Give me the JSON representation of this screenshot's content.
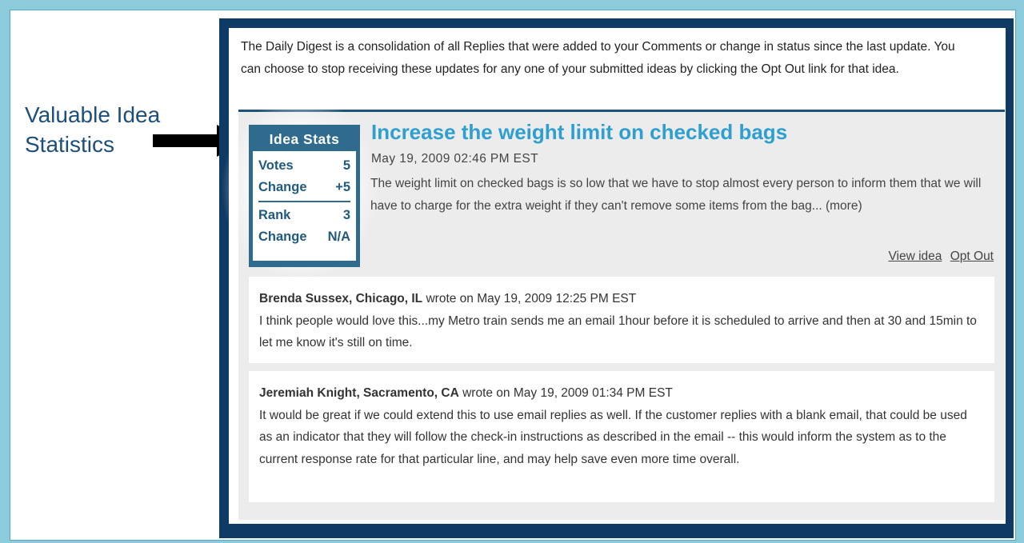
{
  "callout": {
    "line1": "Valuable Idea",
    "line2": "Statistics"
  },
  "intro_text": "The Daily Digest is a consolidation of all Replies  that were added to your Comments or change in status since the last update. You can choose to stop receiving these updates for any one of your submitted ideas by clicking the Opt Out link for that idea.",
  "stats": {
    "title": "Idea Stats",
    "rows": [
      {
        "label": "Votes",
        "value": "5"
      },
      {
        "label": "Change",
        "value": "+5"
      },
      {
        "label": "Rank",
        "value": "3"
      },
      {
        "label": "Change",
        "value": "N/A"
      }
    ]
  },
  "idea": {
    "title": "Increase the weight limit on checked bags",
    "date": "May 19, 2009 02:46 PM EST",
    "description": "The weight limit on checked bags is so low that we have to stop almost every person to inform them that we will have to charge for the extra weight if they can't remove some items from the bag... (more)",
    "view_link": "View idea",
    "opt_out_link": "Opt Out"
  },
  "replies": [
    {
      "author": "Brenda Sussex, Chicago, IL",
      "meta": " wrote on May 19, 2009 12:25 PM EST",
      "text": "I think people would love this...my Metro train sends me an email 1hour before it is scheduled to arrive and then at 30 and 15min to let me know it's still on time."
    },
    {
      "author": "Jeremiah Knight, Sacramento, CA",
      "meta": " wrote on May 19, 2009 01:34 PM EST",
      "text": "It would be great if we could extend this to use email replies as well. If the customer replies with a blank email, that could be used as an indicator that they will follow the check-in instructions as described in the email -- this would inform the system as to the current response rate for that particular line, and may help save even more time overall."
    }
  ],
  "colors": {
    "frame": "#8ccbdc",
    "email_border": "#0f3a66",
    "title": "#2e9fcf",
    "stats": "#2f6b8d"
  }
}
